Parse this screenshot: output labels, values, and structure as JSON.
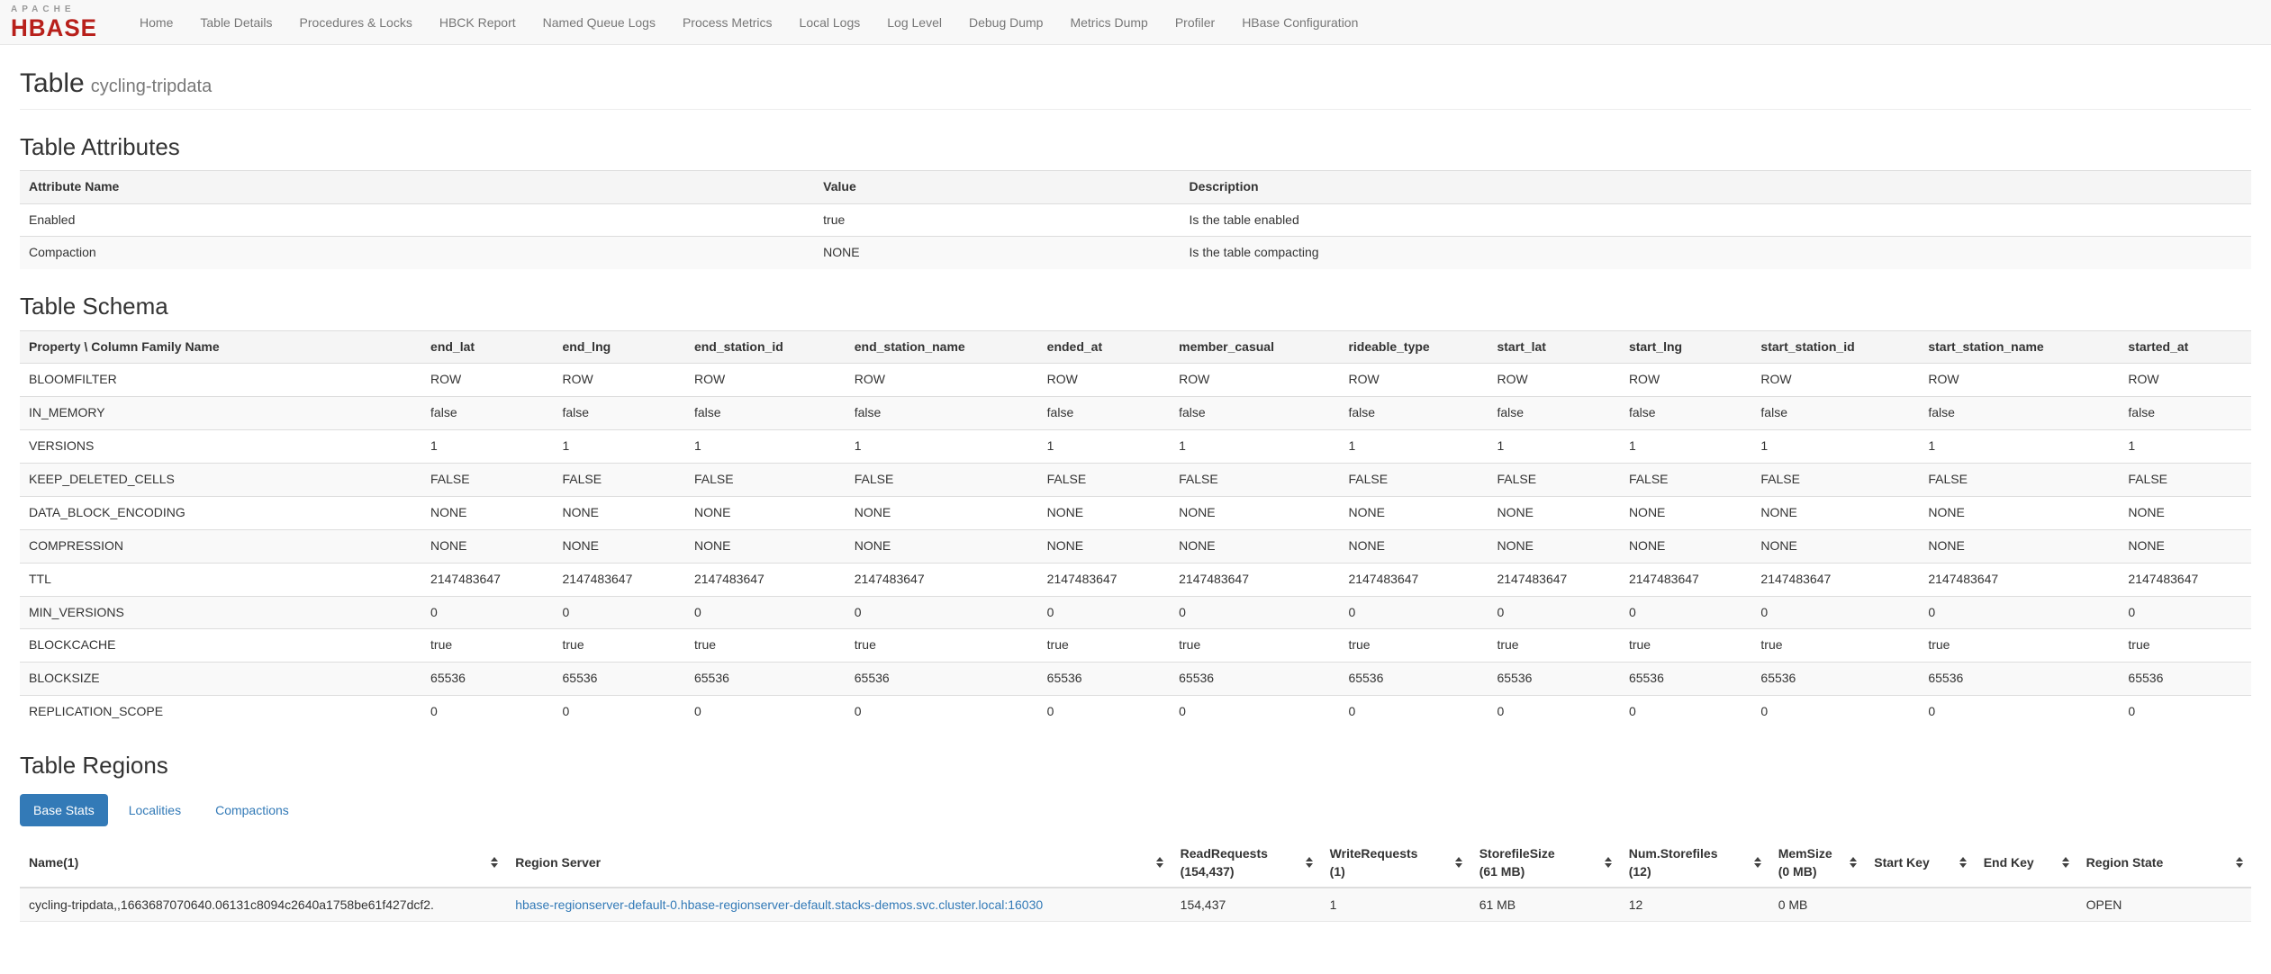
{
  "nav": {
    "brand": {
      "top": "APACHE",
      "bottom": "HBASE"
    },
    "items": [
      "Home",
      "Table Details",
      "Procedures & Locks",
      "HBCK Report",
      "Named Queue Logs",
      "Process Metrics",
      "Local Logs",
      "Log Level",
      "Debug Dump",
      "Metrics Dump",
      "Profiler",
      "HBase Configuration"
    ]
  },
  "page": {
    "title": "Table",
    "subtitle": "cycling-tripdata"
  },
  "attributes": {
    "heading": "Table Attributes",
    "columns": [
      "Attribute Name",
      "Value",
      "Description"
    ],
    "rows": [
      {
        "name": "Enabled",
        "value": "true",
        "description": "Is the table enabled"
      },
      {
        "name": "Compaction",
        "value": "NONE",
        "description": "Is the table compacting"
      }
    ]
  },
  "schema": {
    "heading": "Table Schema",
    "corner_header": "Property \\ Column Family Name",
    "column_families": [
      "end_lat",
      "end_lng",
      "end_station_id",
      "end_station_name",
      "ended_at",
      "member_casual",
      "rideable_type",
      "start_lat",
      "start_lng",
      "start_station_id",
      "start_station_name",
      "started_at"
    ],
    "rows": [
      {
        "property": "BLOOMFILTER",
        "value": "ROW"
      },
      {
        "property": "IN_MEMORY",
        "value": "false"
      },
      {
        "property": "VERSIONS",
        "value": "1"
      },
      {
        "property": "KEEP_DELETED_CELLS",
        "value": "FALSE"
      },
      {
        "property": "DATA_BLOCK_ENCODING",
        "value": "NONE"
      },
      {
        "property": "COMPRESSION",
        "value": "NONE"
      },
      {
        "property": "TTL",
        "value": "2147483647"
      },
      {
        "property": "MIN_VERSIONS",
        "value": "0"
      },
      {
        "property": "BLOCKCACHE",
        "value": "true"
      },
      {
        "property": "BLOCKSIZE",
        "value": "65536"
      },
      {
        "property": "REPLICATION_SCOPE",
        "value": "0"
      }
    ]
  },
  "regions": {
    "heading": "Table Regions",
    "tabs": [
      {
        "label": "Base Stats",
        "active": true
      },
      {
        "label": "Localities",
        "active": false
      },
      {
        "label": "Compactions",
        "active": false
      }
    ],
    "columns": [
      {
        "label": "Name(1)",
        "width": "21.8%"
      },
      {
        "label": "Region Server",
        "width": "29.8%"
      },
      {
        "label": "ReadRequests",
        "sub": "(154,437)",
        "width": "6.7%"
      },
      {
        "label": "WriteRequests",
        "sub": "(1)",
        "width": "6.7%"
      },
      {
        "label": "StorefileSize",
        "sub": "(61 MB)",
        "width": "6.7%"
      },
      {
        "label": "Num.Storefiles",
        "sub": "(12)",
        "width": "6.7%"
      },
      {
        "label": "MemSize",
        "sub": "(0 MB)",
        "width": "4.3%"
      },
      {
        "label": "Start Key",
        "width": "4.9%"
      },
      {
        "label": "End Key",
        "width": "4.6%"
      },
      {
        "label": "Region State",
        "width": "7.8%"
      }
    ],
    "rows": [
      {
        "name": "cycling-tripdata,,1663687070640.06131c8094c2640a1758be61f427dcf2.",
        "region_server": "hbase-regionserver-default-0.hbase-regionserver-default.stacks-demos.svc.cluster.local:16030",
        "read_requests": "154,437",
        "write_requests": "1",
        "storefile_size": "61 MB",
        "num_storefiles": "12",
        "mem_size": "0 MB",
        "start_key": "",
        "end_key": "",
        "region_state": "OPEN"
      }
    ]
  },
  "colors": {
    "link_blue": "#337ab7",
    "active_tab_bg": "#337ab7",
    "brand_red": "#b8201b",
    "navbar_bg": "#f8f8f8",
    "stripe_bg": "#f9f9f9",
    "header_row_bg": "#f5f5f5"
  },
  "icons": {
    "sort": "sort-icon"
  }
}
